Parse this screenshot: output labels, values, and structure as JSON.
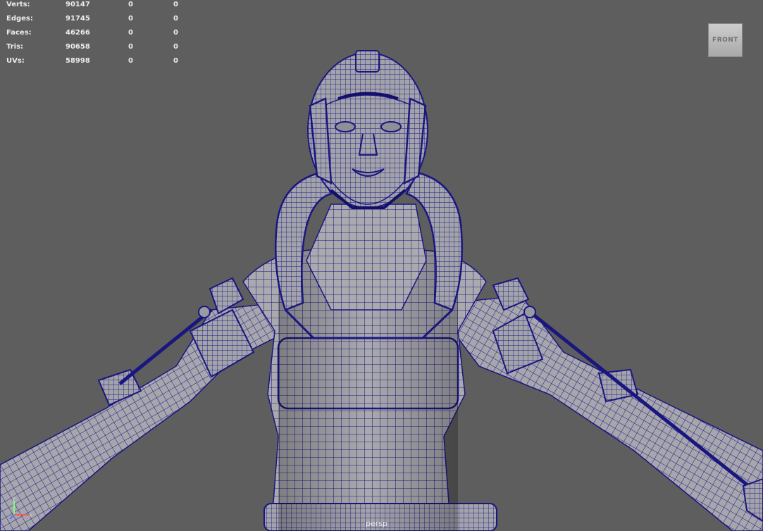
{
  "stats": [
    {
      "label": "Verts:",
      "v1": "90147",
      "v2": "0",
      "v3": "0"
    },
    {
      "label": "Edges:",
      "v1": "91745",
      "v2": "0",
      "v3": "0"
    },
    {
      "label": "Faces:",
      "v1": "46266",
      "v2": "0",
      "v3": "0"
    },
    {
      "label": "Tris:",
      "v1": "90658",
      "v2": "0",
      "v3": "0"
    },
    {
      "label": "UVs:",
      "v1": "58998",
      "v2": "0",
      "v3": "0"
    }
  ],
  "viewcube": {
    "label": "FRONT"
  },
  "camera": {
    "label": "persp"
  },
  "axis": {
    "y": "y",
    "x": "x"
  },
  "colors": {
    "background": "#5e5e5e",
    "mesh_fill": "#a7a7ad",
    "wire": "#1a1680",
    "hud_text": "#ececec"
  }
}
